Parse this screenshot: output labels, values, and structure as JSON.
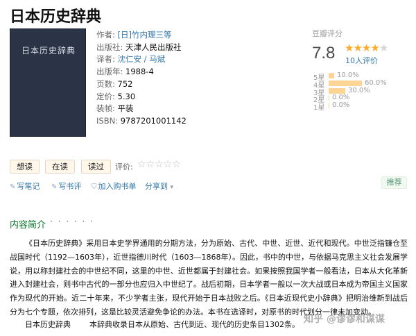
{
  "book": {
    "title": "日本历史辞典",
    "cover_text": "日本历史辞典"
  },
  "info": [
    {
      "key": "作者:",
      "value": "[日]竹内理三等",
      "link": true
    },
    {
      "key": "出版社:",
      "value": "天津人民出版社",
      "link": false
    },
    {
      "key": "译者:",
      "value": "沈仁安 / 马斌",
      "link": true
    },
    {
      "key": "出版年:",
      "value": "1988-4",
      "link": false
    },
    {
      "key": "页数:",
      "value": "752",
      "link": false
    },
    {
      "key": "定价:",
      "value": "5.30",
      "link": false
    },
    {
      "key": "装帧:",
      "value": "平装",
      "link": false
    },
    {
      "key": "ISBN:",
      "value": "9787201001142",
      "link": false
    }
  ],
  "rating": {
    "label": "豆瓣评分",
    "score": "7.8",
    "stars_filled": 4,
    "stars_total": 5,
    "count": "10人评价",
    "distribution": [
      {
        "label": "5星",
        "percent": 10.0,
        "text": "10.0%"
      },
      {
        "label": "4星",
        "percent": 60.0,
        "text": "60.0%"
      },
      {
        "label": "3星",
        "percent": 30.0,
        "text": "30.0%"
      },
      {
        "label": "2星",
        "percent": 0.0,
        "text": "0.0%"
      },
      {
        "label": "1星",
        "percent": 0.0,
        "text": "0.0%"
      }
    ]
  },
  "buttons": {
    "want": "想读",
    "reading": "在读",
    "read": "读过",
    "rate_label": "评价:",
    "rate_stars": "☆☆☆☆☆"
  },
  "actions": {
    "note": "写笔记",
    "review": "写书评",
    "buy": "加入购书单",
    "share": "分享到",
    "recommend": "推荐"
  },
  "intro": {
    "title": "内容简介",
    "dots": "· · · · · ·",
    "paragraph": "《日本历史辞典》采用日本史学界通用的分期方法，分为原始、古代、中世、近世、近代和现代。中世泛指镰仓至战国时代（1192—1603年），近世指德川时代（1603—1868年）。因此，书中的中世，与依据马克思主义社会发展学说，用以称封建社会的中世纪不同，这里的中世、近世都属于封建社会。如果按照我国学者一般看法，日本从大化革新进入封建社会，则书中古代的一部分也应归入中世纪了。战后初期，日本学者一般以一次大战或日本成为帝国主义国家作为现代的开始。近二十年来，不少学者主张，现代开始于日本战败之后。《日本近现代史小辞典》把明治维新到战后分为七个专题，依次排列，这是比较灵活避免争论的办法。本书在选译时，对原书的时代划分一律未加变动。",
    "last_line_a": "日本历史辞典",
    "last_line_b": "本辞典收录日本从原始、古代到近、现代的历史条目1302条。"
  },
  "watermark": "知乎 @谬谬和谋谋"
}
